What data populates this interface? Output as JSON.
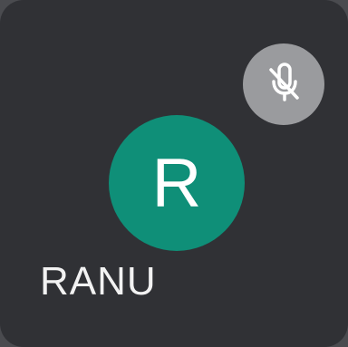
{
  "participant": {
    "name": "RANU",
    "initial": "R",
    "avatar_color": "#0f8f78",
    "tile_color": "#303135"
  },
  "mute_indicator": {
    "icon": "mic-off-icon",
    "badge_color": "#9a9b9e"
  }
}
